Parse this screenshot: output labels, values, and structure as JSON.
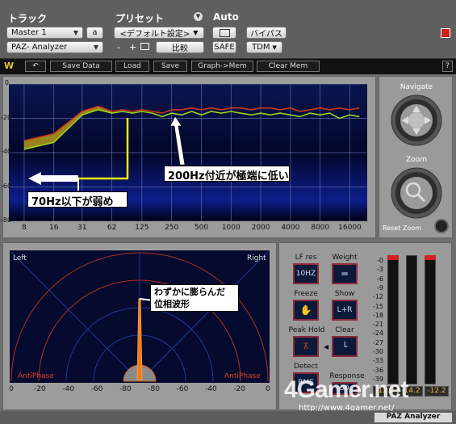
{
  "host": {
    "track_label": "トラック",
    "preset_label": "プリセット",
    "auto_label": "Auto",
    "track_name": "Master 1",
    "track_channel": "a",
    "plugin_name": "PAZ- Analyzer",
    "preset_name": "<デフォルト設定>",
    "minus": "-",
    "plus": "+",
    "compare": "比較",
    "safe": "SAFE",
    "bypass": "バイパス",
    "tdm": "TDM"
  },
  "toolbar": {
    "save_data": "Save Data",
    "load": "Load",
    "save": "Save",
    "graph_mem": "Graph->Mem",
    "clear_mem": "Clear Mem",
    "help": "?"
  },
  "spectrum": {
    "y_ticks": [
      "0",
      "-20",
      "-40",
      "-60",
      "-80"
    ],
    "x_ticks": [
      "8",
      "16",
      "31",
      "62",
      "125",
      "250",
      "500",
      "1000",
      "2000",
      "4000",
      "8000",
      "16000"
    ],
    "annotation_low": "70Hz以下が弱め",
    "annotation_200": "200Hz付近が極端に低い"
  },
  "chart_data": {
    "type": "line",
    "x": [
      8,
      16,
      31,
      45,
      62,
      80,
      100,
      125,
      160,
      200,
      250,
      315,
      400,
      500,
      630,
      800,
      1000,
      1250,
      1600,
      2000,
      2500,
      3150,
      4000,
      5000,
      6300,
      8000,
      10000,
      12500,
      16000,
      20000
    ],
    "series": [
      {
        "color": "#c83a1a",
        "values": [
          -33,
          -29,
          -16,
          -13,
          -16,
          -15,
          -16,
          -15,
          -16,
          -17,
          -15,
          -15,
          -14,
          -15,
          -14,
          -15,
          -14,
          -14,
          -15,
          -14,
          -14,
          -15,
          -14,
          -16,
          -15,
          -14,
          -15,
          -14,
          -15,
          -14
        ]
      },
      {
        "color": "#9ad21c",
        "values": [
          -38,
          -34,
          -18,
          -15,
          -17,
          -16,
          -17,
          -16,
          -17,
          -19,
          -17,
          -18,
          -16,
          -18,
          -16,
          -17,
          -16,
          -17,
          -18,
          -17,
          -18,
          -17,
          -18,
          -19,
          -17,
          -18,
          -17,
          -20,
          -18,
          -19
        ]
      }
    ],
    "xlabel": "",
    "ylabel": "",
    "ylim": [
      -80,
      0
    ],
    "x_scale": "log",
    "grid": true
  },
  "nav": {
    "navigate_label": "Navigate",
    "zoom_label": "Zoom",
    "reset_zoom_label": "Reset Zoom"
  },
  "scope": {
    "left_label": "Left",
    "right_label": "Right",
    "anti_left": "AntiPhase",
    "anti_right": "AntiPhase",
    "annotation": "わずかに膨らんだ位相波形",
    "annotation_line1": "わずかに膨らんだ",
    "annotation_line2": "位相波形",
    "x_ticks": [
      "0",
      "-20",
      "-40",
      "-60",
      "-80",
      "-80",
      "-60",
      "-40",
      "-20",
      "0"
    ]
  },
  "controls": {
    "lf_res_label": "LF res",
    "lf_res_value": "10HZ",
    "weight_label": "Weight",
    "freeze_label": "Freeze",
    "show_label": "Show",
    "show_value": "L+R",
    "peak_hold_label": "Peak Hold",
    "clear_label": "Clear",
    "detect_label": "Detect",
    "detect_value": "RMS",
    "response_label": "Response",
    "response_value": "50"
  },
  "meters": {
    "scale": [
      "-0",
      "-3",
      "-6",
      "-9",
      "-12",
      "-15",
      "-18",
      "-21",
      "-24",
      "-27",
      "-30",
      "-33",
      "-36",
      "-39"
    ],
    "readouts": [
      "-12.2",
      "-14.2",
      "-12.2"
    ]
  },
  "footer": {
    "title": "PAZ Analyzer",
    "watermark": "4Gamer.net",
    "watermark_url": "http://www.4gamer.net/"
  }
}
